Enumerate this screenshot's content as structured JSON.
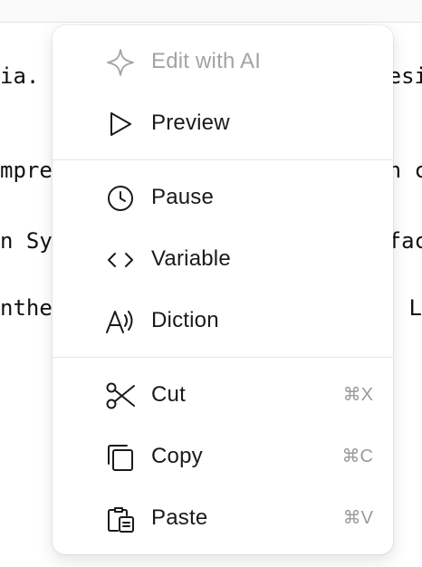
{
  "document": {
    "lines": [
      {
        "left": "ia.",
        "right": "esi"
      },
      {
        "left": "mpre",
        "right": "n c"
      },
      {
        "left": "n Sy",
        "right": "fac"
      },
      {
        "left": "nthe",
        "right": "L"
      }
    ]
  },
  "menu": {
    "edit_ai": {
      "label": "Edit with AI",
      "icon": "sparkle-icon",
      "disabled": true
    },
    "preview": {
      "label": "Preview",
      "icon": "play-icon"
    },
    "pause": {
      "label": "Pause",
      "icon": "clock-icon"
    },
    "variable": {
      "label": "Variable",
      "icon": "code-brackets-icon"
    },
    "diction": {
      "label": "Diction",
      "icon": "speech-wave-icon"
    },
    "cut": {
      "label": "Cut",
      "shortcut": "⌘X",
      "icon": "scissors-icon"
    },
    "copy": {
      "label": "Copy",
      "shortcut": "⌘C",
      "icon": "copy-icon"
    },
    "paste": {
      "label": "Paste",
      "shortcut": "⌘V",
      "icon": "clipboard-icon"
    }
  },
  "colors": {
    "text": "#1a1a1a",
    "disabled": "#a3a3a3",
    "shortcut": "#9a9a9a",
    "separator": "#e6e6e6"
  }
}
